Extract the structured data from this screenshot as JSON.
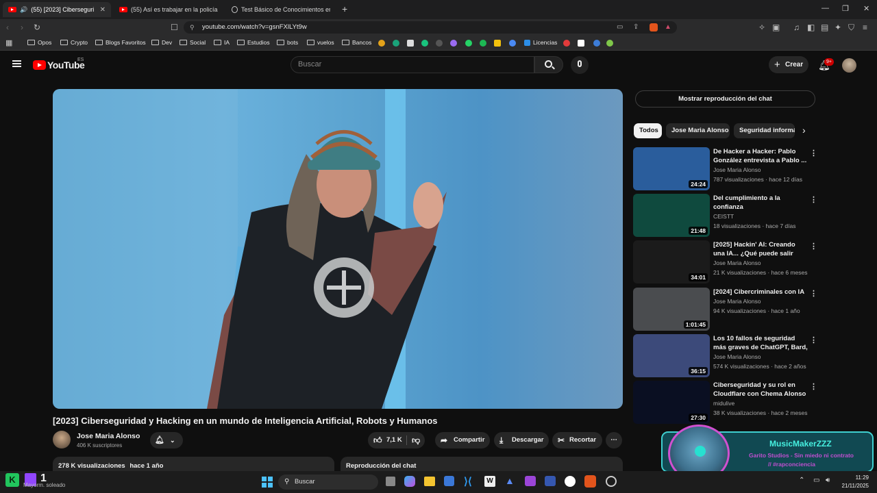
{
  "browser": {
    "tabs": [
      {
        "title": "(55) [2023] Ciberseguridad y",
        "active": true
      },
      {
        "title": "(55) Así es trabajar en la policía com",
        "active": false
      },
      {
        "title": "Test Básico de Conocimientos en Inst",
        "active": false
      }
    ],
    "new_tab": "+",
    "url": "youtube.com/watch?v=gsnFXlLYt9w",
    "bookmarks": [
      "Opos",
      "Crypto",
      "Blogs Favoritos",
      "Dev",
      "Social",
      "IA",
      "Estudios",
      "bots",
      "vuelos",
      "Bancos",
      "Licencias"
    ]
  },
  "youtube": {
    "logo": "YouTube",
    "region": "ES",
    "search_placeholder": "Buscar",
    "create_label": "Crear",
    "notif_badge": "9+"
  },
  "video": {
    "title": "[2023] Ciberseguridad y Hacking en un mundo de Inteligencia Artificial, Robots y Humanos",
    "channel": "Jose Maria Alonso",
    "subscribers": "406 K suscriptores",
    "likes": "7,1 K",
    "share_label": "Compartir",
    "download_label": "Descargar",
    "clip_label": "Recortar",
    "views": "278 K visualizaciones",
    "age": "hace 1 año",
    "chat_replay_label": "Reproducción del chat"
  },
  "sidebar": {
    "chat_button": "Mostrar reproducción del chat",
    "chips": [
      "Todos",
      "Jose Maria Alonso",
      "Seguridad informá"
    ],
    "recommendations": [
      {
        "title": "De Hacker a Hacker: Pablo González entrevista a Pablo ...",
        "channel": "Jose Maria Alonso",
        "meta": "787 visualizaciones · hace 12 días",
        "duration": "24:24",
        "color": "#2a5d9c"
      },
      {
        "title": "Del cumplimiento a la confianza",
        "channel": "CEISTT",
        "meta": "18 visualizaciones · hace 7 días",
        "duration": "21:48",
        "color": "#0f4a3e"
      },
      {
        "title": "[2025] Hackin' AI: Creando una IA... ¿Qué puede salir mal? por...",
        "channel": "Jose Maria Alonso",
        "meta": "21 K visualizaciones · hace 6 meses",
        "duration": "34:01",
        "color": "#1b1b1b"
      },
      {
        "title": "[2024] Cibercriminales con IA",
        "channel": "Jose Maria Alonso",
        "meta": "94 K visualizaciones · hace 1 año",
        "duration": "1:01:45",
        "color": "#4a4c4f"
      },
      {
        "title": "Los 10 fallos de seguridad más graves de ChatGPT, Bard, Llam...",
        "channel": "Jose Maria Alonso",
        "meta": "574 K visualizaciones · hace 2 años",
        "duration": "36:15",
        "color": "#3c4a7a"
      },
      {
        "title": "Ciberseguridad y su rol en Cloudflare con Chema Alonso ...",
        "channel": "midulive",
        "meta": "38 K visualizaciones · hace 2 meses",
        "duration": "27:30",
        "color": "#0a0f22"
      }
    ]
  },
  "overlay": {
    "name": "MusicMakerZZZ",
    "line1": "Garito Studios - Sin miedo ni contrato",
    "line2": "// #rapconciencia"
  },
  "taskbar": {
    "weather": "Mayorm. soleado",
    "search": "Buscar",
    "time": "11:29",
    "date": "21/11/2025",
    "count": "1"
  }
}
